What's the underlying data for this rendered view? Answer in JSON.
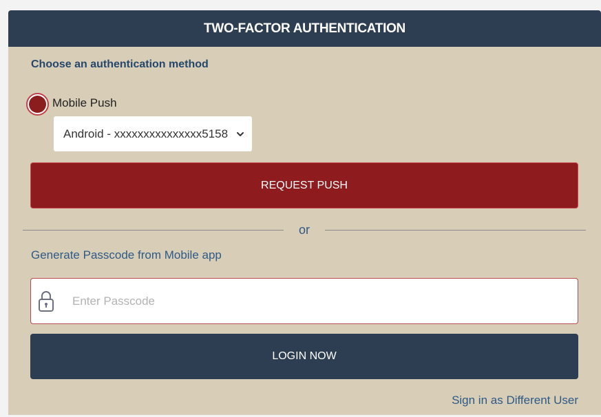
{
  "header": {
    "title": "TWO-FACTOR AUTHENTICATION"
  },
  "method": {
    "choose_label": "Choose an authentication method",
    "radio_label": "Mobile Push",
    "device_selected": "Android - xxxxxxxxxxxxxxx5158",
    "push_button": "REQUEST PUSH"
  },
  "divider": {
    "text": "or"
  },
  "passcode": {
    "label": "Generate Passcode from Mobile app",
    "placeholder": "Enter Passcode",
    "login_button": "LOGIN NOW"
  },
  "footer": {
    "different_user_link": "Sign in as Different User"
  },
  "colors": {
    "header_bg": "#2e3e52",
    "panel_bg": "#d8cdb6",
    "push_button_bg": "#8e1c1e",
    "link_text": "#2e5a86"
  },
  "icons": {
    "lock": "lock-icon",
    "chevron": "chevron-down-icon"
  }
}
